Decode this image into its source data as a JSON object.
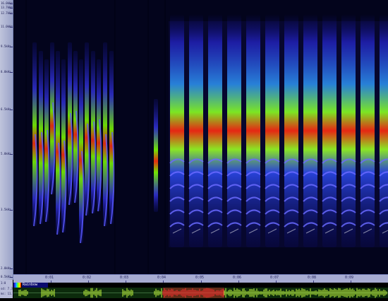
{
  "freq_axis": {
    "labels": [
      "16.0kHz",
      "13.7kHz",
      "12.7kHz",
      "11.0kHz",
      "9.5kHz",
      "8.0kHz",
      "6.5kHz",
      "5.0kHz",
      "3.5kHz",
      "2.0kHz",
      "0.5kHz"
    ]
  },
  "time_axis": {
    "labels": [
      "0:01",
      "0:02",
      "0:03",
      "0:04",
      "0:05",
      "0:06",
      "0:07",
      "0:08",
      "0:09"
    ]
  },
  "bottom_info": {
    "line1": "1:0",
    "line2": "sd: 7.3",
    "line3": "ms: 11.0"
  },
  "palette": {
    "name": "Rainbow",
    "colors": [
      "#0a0a80",
      "#3333ff",
      "#00d0ff",
      "#7cff00",
      "#ffee00",
      "#ff0000"
    ]
  },
  "waveform": {
    "selection_color": "#ff3030",
    "wave_color": "#c8ff40",
    "background": "#0c2b0c"
  },
  "spectrogram": {
    "background": "#03041c"
  }
}
